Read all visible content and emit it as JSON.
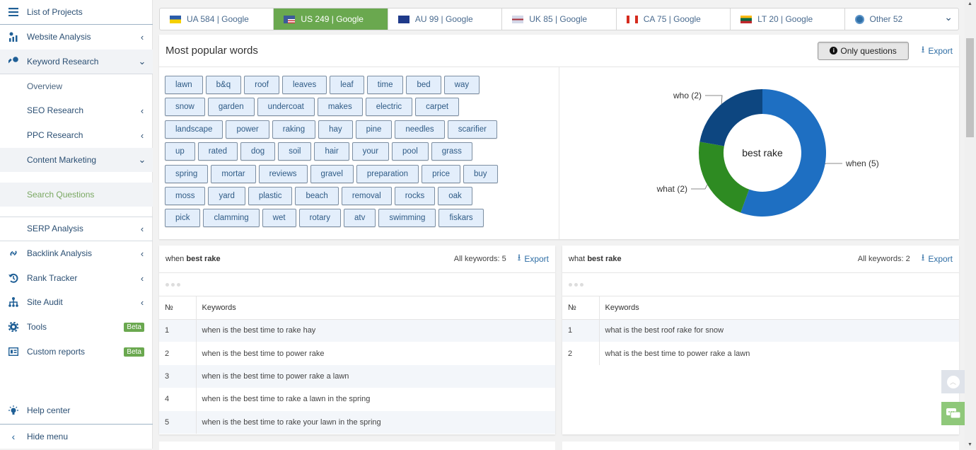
{
  "sidebar": {
    "projects_label": "List of Projects",
    "items": [
      {
        "label": "Website Analysis",
        "icon": "chart-icon"
      },
      {
        "label": "Keyword Research",
        "icon": "key-icon"
      },
      {
        "label": "Overview"
      },
      {
        "label": "SEO Research"
      },
      {
        "label": "PPC Research"
      },
      {
        "label": "Content Marketing"
      },
      {
        "label": "Search Questions"
      },
      {
        "label": "SERP Analysis"
      },
      {
        "label": "Backlink Analysis",
        "icon": "link-icon"
      },
      {
        "label": "Rank Tracker",
        "icon": "history-icon"
      },
      {
        "label": "Site Audit",
        "icon": "sitemap-icon"
      },
      {
        "label": "Tools",
        "icon": "gear-icon",
        "badge": "Beta"
      },
      {
        "label": "Custom reports",
        "icon": "report-icon",
        "badge": "Beta"
      }
    ],
    "help_label": "Help center",
    "hide_label": "Hide menu"
  },
  "country_tabs": [
    {
      "label": "UA 584 | Google",
      "active": false
    },
    {
      "label": "US 249 | Google",
      "active": true
    },
    {
      "label": "AU 99 | Google",
      "active": false
    },
    {
      "label": "UK 85 | Google",
      "active": false
    },
    {
      "label": "CA 75 | Google",
      "active": false
    },
    {
      "label": "LT 20 | Google",
      "active": false
    },
    {
      "label": "Other 52",
      "active": false
    }
  ],
  "popular": {
    "title": "Most popular words",
    "only_questions_label": "Only questions",
    "export_label": "Export",
    "words": [
      "lawn",
      "b&q",
      "roof",
      "leaves",
      "leaf",
      "time",
      "bed",
      "way",
      "snow",
      "garden",
      "undercoat",
      "makes",
      "electric",
      "carpet",
      "landscape",
      "power",
      "raking",
      "hay",
      "pine",
      "needles",
      "scarifier",
      "up",
      "rated",
      "dog",
      "soil",
      "hair",
      "your",
      "pool",
      "grass",
      "spring",
      "mortar",
      "reviews",
      "gravel",
      "preparation",
      "price",
      "buy",
      "moss",
      "yard",
      "plastic",
      "beach",
      "removal",
      "rocks",
      "oak",
      "pick",
      "clamming",
      "wet",
      "rotary",
      "atv",
      "swimming",
      "fiskars"
    ]
  },
  "chart_data": {
    "type": "pie",
    "title": "best rake",
    "donut": true,
    "categories": [
      "when",
      "what",
      "who"
    ],
    "values": [
      5,
      2,
      2
    ],
    "labels": [
      "when (5)",
      "what (2)",
      "who (2)"
    ],
    "colors": [
      "#1e6fc2",
      "#2e8b22",
      "#0d4680"
    ]
  },
  "table_when": {
    "title_prefix": "when",
    "title_bold": "best rake",
    "all_keywords": "All keywords: 5",
    "export_label": "Export",
    "col_no": "№",
    "col_keywords": "Keywords",
    "rows": [
      {
        "n": "1",
        "kw": "when is the best time to rake hay"
      },
      {
        "n": "2",
        "kw": "when is the best time to power rake"
      },
      {
        "n": "3",
        "kw": "when is the best time to power rake a lawn"
      },
      {
        "n": "4",
        "kw": "when is the best time to rake a lawn in the spring"
      },
      {
        "n": "5",
        "kw": "when is the best time to rake your lawn in the spring"
      }
    ]
  },
  "table_what": {
    "title_prefix": "what",
    "title_bold": "best rake",
    "all_keywords": "All keywords: 2",
    "export_label": "Export",
    "col_no": "№",
    "col_keywords": "Keywords",
    "rows": [
      {
        "n": "1",
        "kw": "what is the best roof rake for snow"
      },
      {
        "n": "2",
        "kw": "what is the best time to power rake a lawn"
      }
    ]
  }
}
